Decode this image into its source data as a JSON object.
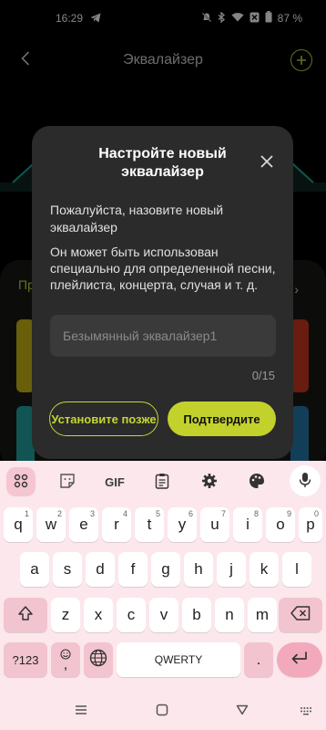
{
  "status_bar": {
    "time": "16:29",
    "battery": "87 %"
  },
  "app": {
    "title": "Эквалайзер"
  },
  "background": {
    "truncated_label": "Пр",
    "arrow_glyph": "›"
  },
  "dialog": {
    "title": "Настройте новый эквалайзер",
    "message1": "Пожалуйста, назовите новый эквалайзер",
    "message2": "Он может быть использован специально для определенной песни, плейлиста, концерта, случая и т. д.",
    "input_placeholder": "Безымянный эквалайзер1",
    "input_value": "",
    "counter": "0/15",
    "later_label": "Установите позже",
    "confirm_label": "Подтвердите"
  },
  "keyboard": {
    "toolbar": {
      "gif_label": "GIF"
    },
    "row1": [
      {
        "c": "q",
        "h": "1"
      },
      {
        "c": "w",
        "h": "2"
      },
      {
        "c": "e",
        "h": "3"
      },
      {
        "c": "r",
        "h": "4"
      },
      {
        "c": "t",
        "h": "5"
      },
      {
        "c": "y",
        "h": "6"
      },
      {
        "c": "u",
        "h": "7"
      },
      {
        "c": "i",
        "h": "8"
      },
      {
        "c": "o",
        "h": "9"
      },
      {
        "c": "p",
        "h": "0"
      }
    ],
    "row2": [
      "a",
      "s",
      "d",
      "f",
      "g",
      "h",
      "j",
      "k",
      "l"
    ],
    "row3": [
      "z",
      "x",
      "c",
      "v",
      "b",
      "n",
      "m"
    ],
    "symbols_label": "?123",
    "comma": ",",
    "period": ".",
    "space_label": "QWERTY"
  },
  "colors": {
    "accent": "#c6d633",
    "dialog_bg": "#2b2b2b",
    "keyboard_bg": "#fbe7ec",
    "special_key": "#f2c4d0"
  }
}
